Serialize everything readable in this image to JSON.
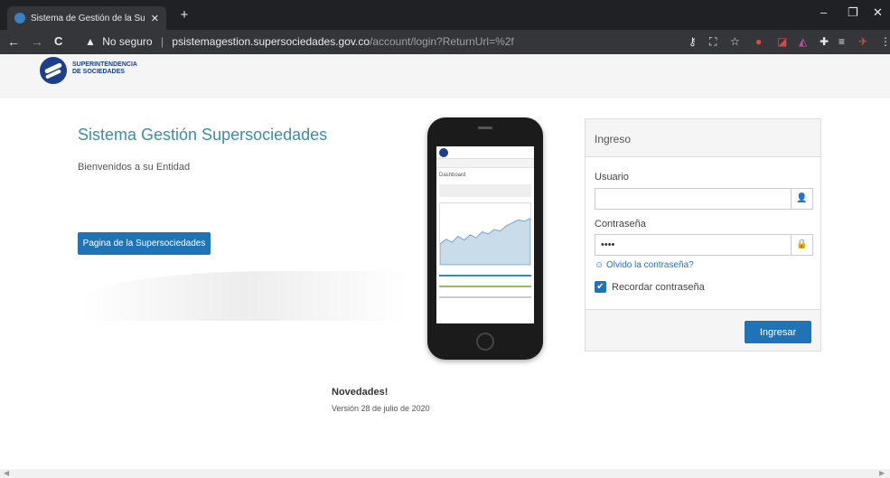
{
  "browser": {
    "tab_title": "Sistema de Gestión de la Superin",
    "tab_close": "✕",
    "new_tab": "+",
    "warn_icon": "▲",
    "security_label": "No seguro",
    "url_host": "psistemagestion.supersociedades.gov.co",
    "url_path": "/account/login?ReturnUrl=%2f",
    "back_glyph": "←",
    "forward_glyph": "→",
    "reload_glyph": "C",
    "minimize_glyph": "–",
    "restore_glyph": "❐",
    "close_glyph": "✕"
  },
  "header": {
    "logo_line1": "SUPERINTENDENCIA",
    "logo_line2": "DE SOCIEDADES"
  },
  "hero": {
    "title": "Sistema Gestión Supersociedades",
    "subtitle": "Bienvenidos a su Entidad",
    "button_label": "Pagina de la Supersociedades"
  },
  "phone_screen": {
    "dashboard_label": "Dashboard",
    "chart_series": [
      28,
      34,
      30,
      38,
      33,
      40,
      36,
      44,
      41,
      47,
      45,
      52,
      56,
      60,
      58,
      62
    ]
  },
  "login": {
    "heading": "Ingreso",
    "user_label": "Usuario",
    "user_value": "",
    "user_icon": "user-icon",
    "password_label": "Contraseña",
    "password_value": "••••",
    "lock_icon": "lock-icon",
    "forgot_label": "Olvido la contraseña?",
    "remember_label": "Recordar contraseña",
    "remember_checked": true,
    "submit_label": "Ingresar"
  },
  "news": {
    "title": "Novedades!",
    "text": "Versión 28 de julio de 2020"
  },
  "colors": {
    "accent": "#1f73b7",
    "title_teal": "#3a8fa8",
    "brand_navy": "#1c3f8c"
  }
}
